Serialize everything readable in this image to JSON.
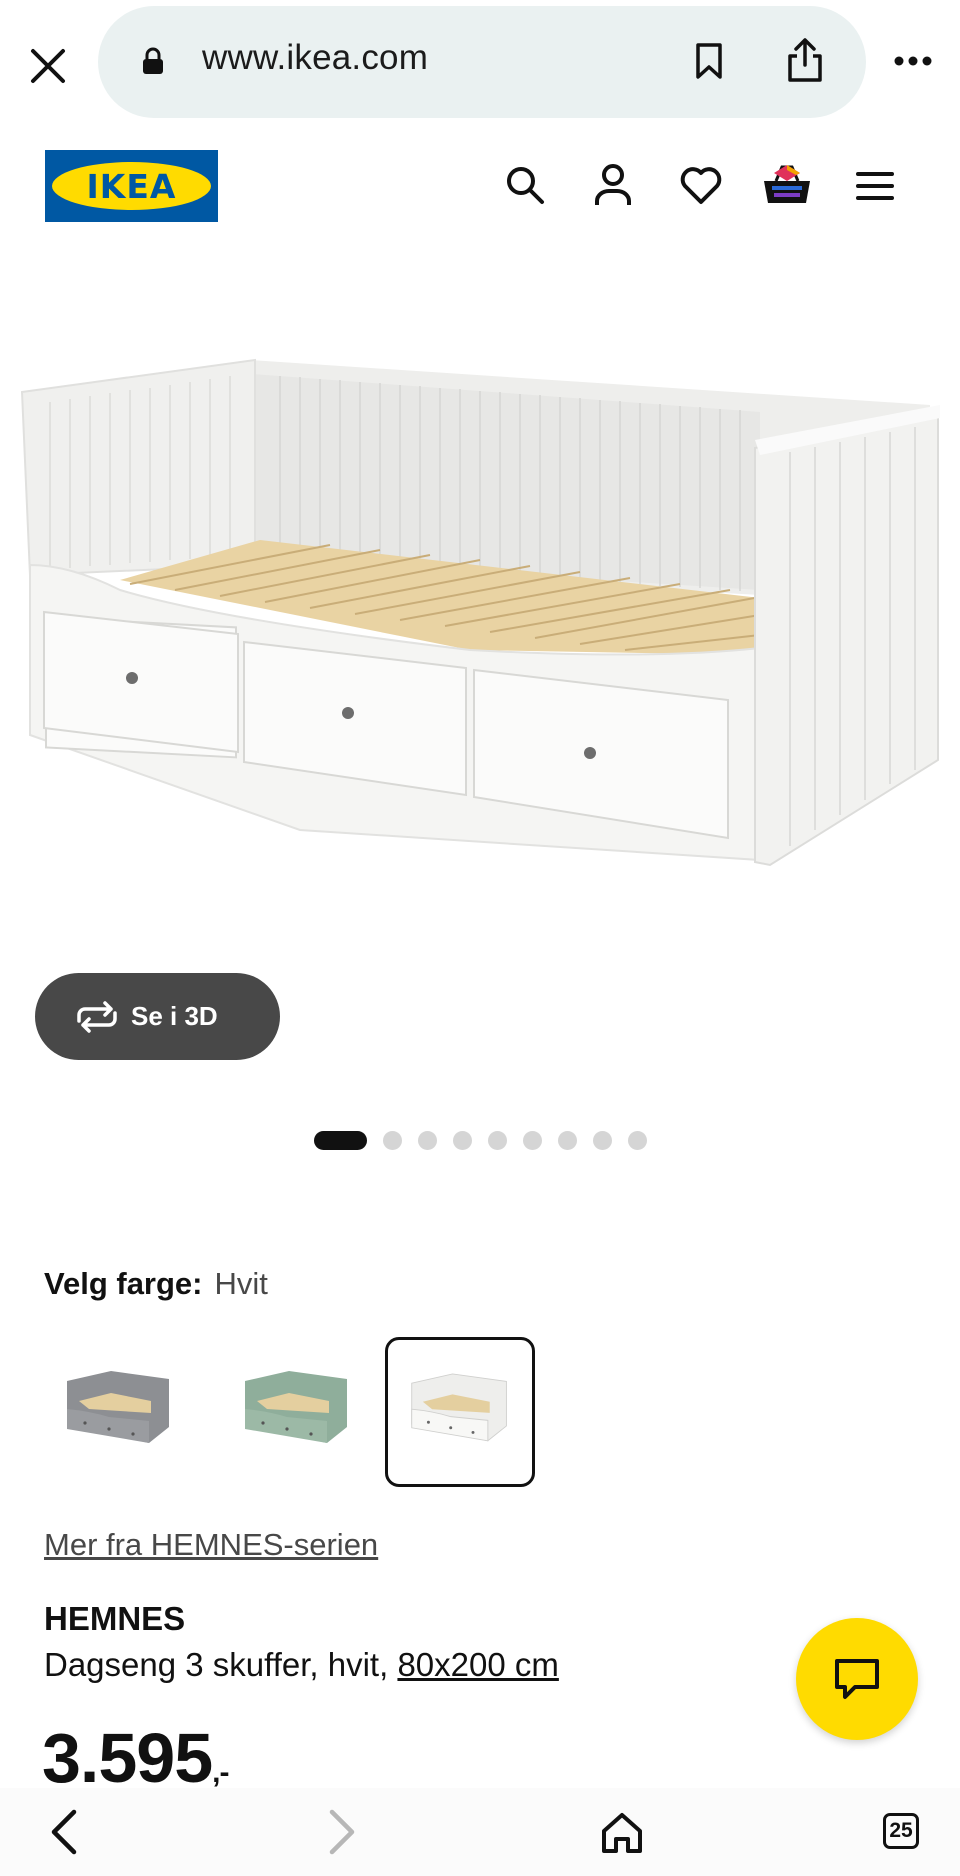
{
  "browser": {
    "url": "www.ikea.com",
    "icons": [
      "close-icon",
      "lock-icon",
      "bookmark-icon",
      "share-icon",
      "more-icon"
    ]
  },
  "header": {
    "logo_text": "IKEA",
    "brand_colors": {
      "blue": "#0058a3",
      "yellow": "#ffdb00"
    },
    "icons": [
      "search-icon",
      "account-icon",
      "wishlist-heart-icon",
      "shopping-bag-icon",
      "menu-icon"
    ]
  },
  "gallery": {
    "view_3d_label": "Se i 3D",
    "image_count": 9,
    "active_index": 0
  },
  "color_picker": {
    "label": "Velg farge:",
    "selected_value": "Hvit",
    "options": [
      {
        "name": "grey",
        "color": "#8d8f93"
      },
      {
        "name": "green",
        "color": "#8fae9b"
      },
      {
        "name": "white",
        "color": "#f3f3f1",
        "selected": true
      }
    ]
  },
  "product": {
    "series_link": "Mer fra HEMNES-serien",
    "name": "HEMNES",
    "description": "Dagseng 3 skuffer, hvit, ",
    "size_link": "80x200 cm",
    "price": "3.595",
    "price_suffix": ",-"
  },
  "chat": {
    "icon": "chat-icon",
    "color": "#ffdb00"
  },
  "browser_nav": {
    "icons": [
      "back-icon",
      "forward-icon",
      "home-icon",
      "tabs-icon"
    ],
    "tab_count": "25"
  }
}
